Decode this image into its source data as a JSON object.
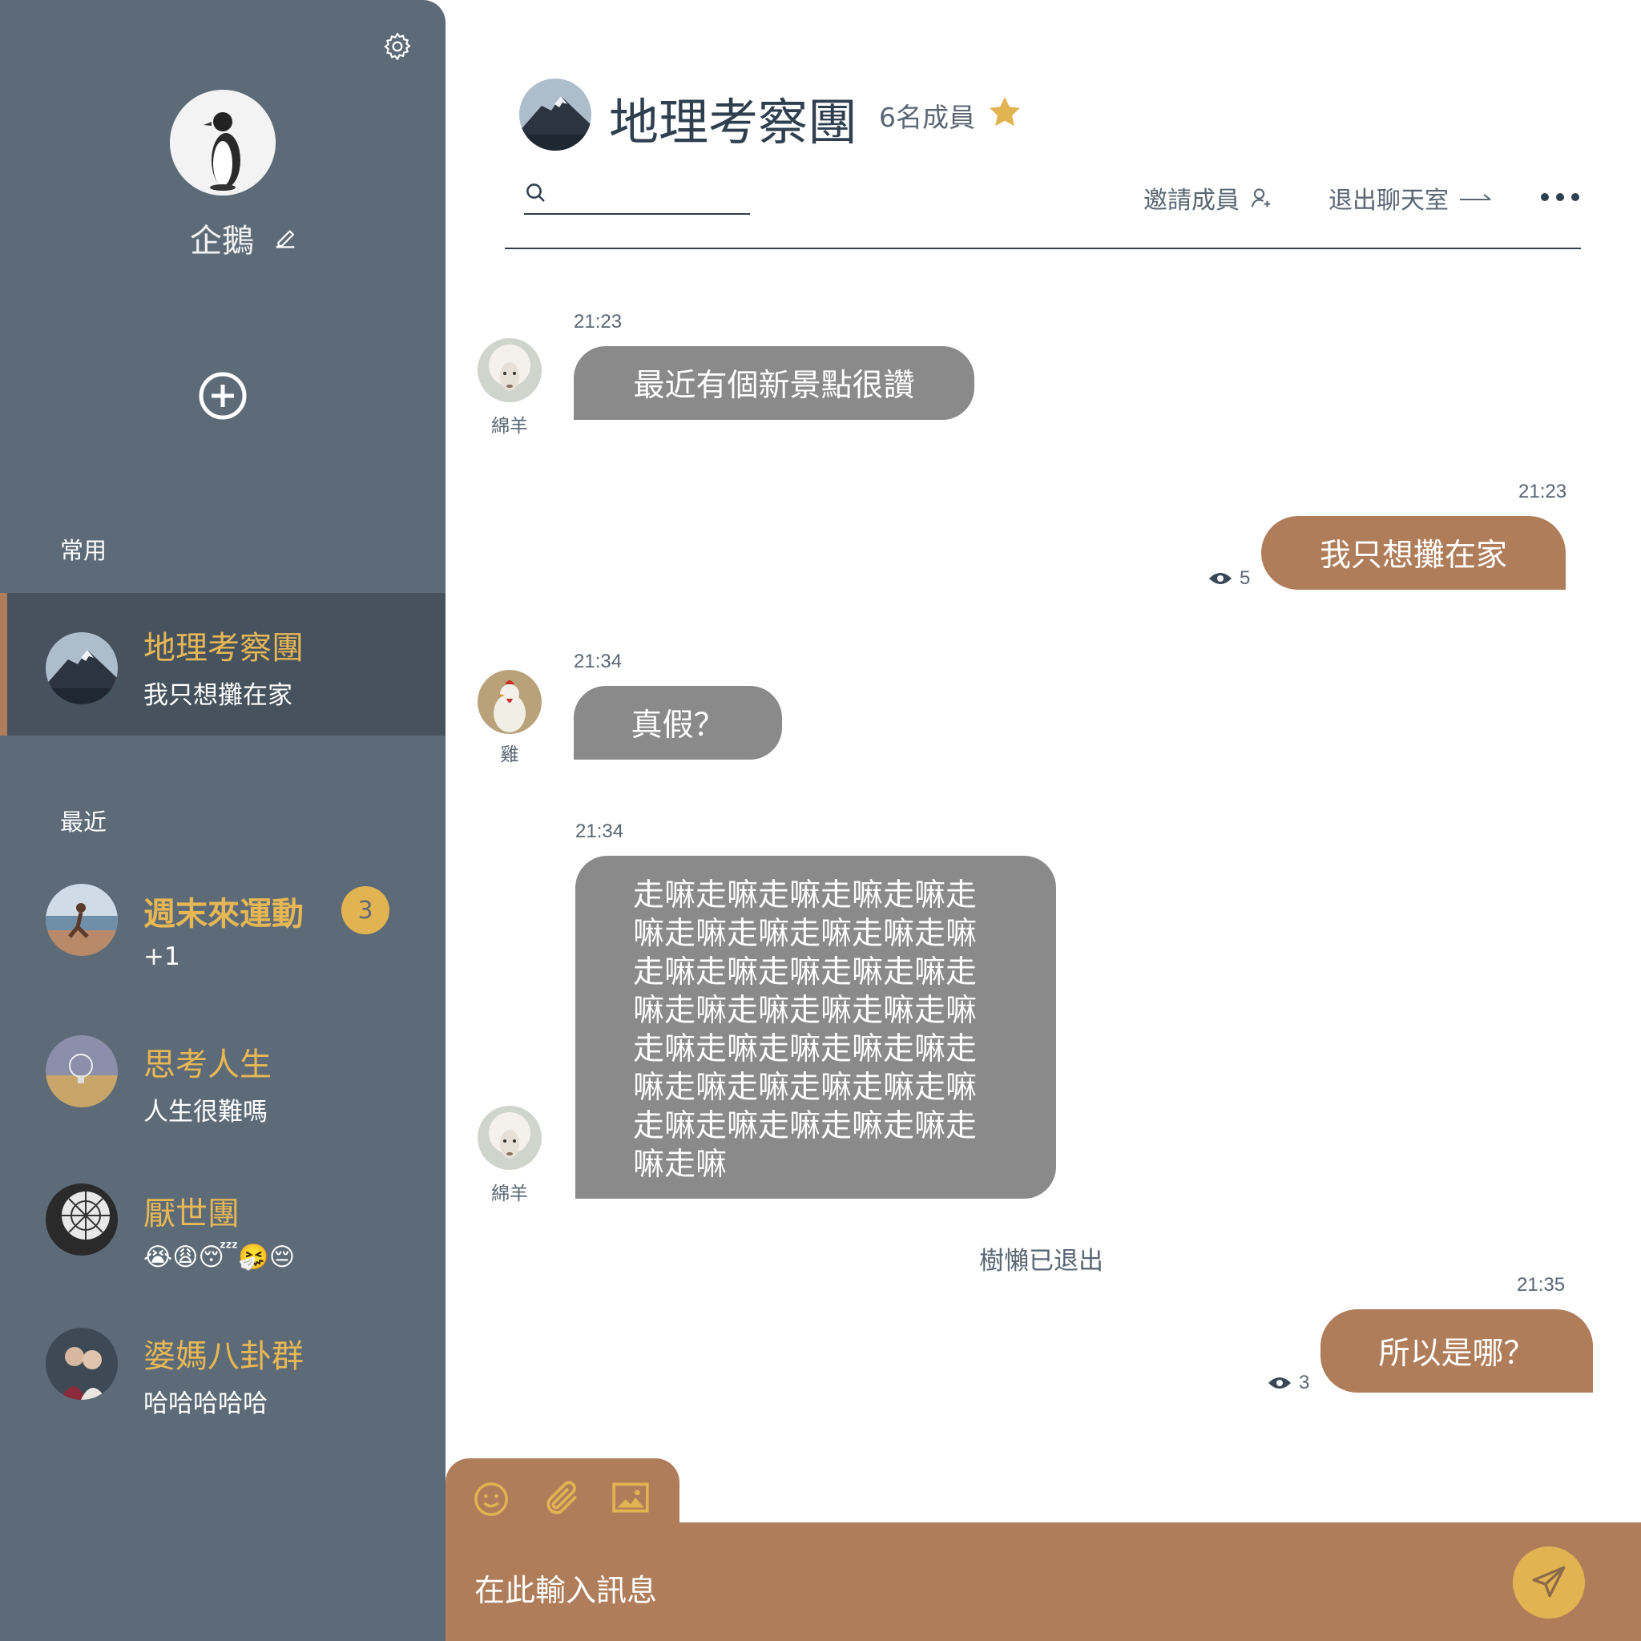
{
  "profile": {
    "name": "企鵝"
  },
  "sidebar": {
    "favorites_title": "常用",
    "recent_title": "最近",
    "favorites": [
      {
        "title": "地理考察團",
        "subtitle": "我只想攤在家"
      }
    ],
    "recent": [
      {
        "title": "週末來運動",
        "subtitle": "+1",
        "badge": "3"
      },
      {
        "title": "思考人生",
        "subtitle": "人生很難嗎"
      },
      {
        "title": "厭世團",
        "subtitle": "😭😩😴🤧😔"
      },
      {
        "title": "婆媽八卦群",
        "subtitle": "哈哈哈哈哈"
      }
    ]
  },
  "header": {
    "title": "地理考察團",
    "members": "6名成員",
    "invite_label": "邀請成員",
    "leave_label": "退出聊天室"
  },
  "messages": [
    {
      "time": "21:23",
      "sender": "綿羊",
      "text": "最近有個新景點很讚"
    },
    {
      "time": "21:23",
      "text": "我只想攤在家",
      "seen": "5"
    },
    {
      "time": "21:34",
      "sender": "雞",
      "text": "真假？"
    },
    {
      "time": "21:34",
      "sender": "綿羊",
      "lines": [
        "走嘛走嘛走嘛走嘛走嘛走",
        "嘛走嘛走嘛走嘛走嘛走嘛",
        "走嘛走嘛走嘛走嘛走嘛走",
        "嘛走嘛走嘛走嘛走嘛走嘛",
        "走嘛走嘛走嘛走嘛走嘛走",
        "嘛走嘛走嘛走嘛走嘛走嘛",
        "走嘛走嘛走嘛走嘛走嘛走",
        "嘛走嘛"
      ]
    },
    {
      "system": "樹懶已退出"
    },
    {
      "time": "21:35",
      "text": "所以是哪？",
      "seen": "3"
    }
  ],
  "composer": {
    "placeholder": "在此輸入訊息"
  },
  "colors": {
    "sidebar": "#5d6b78",
    "accent_gold": "#e2b351",
    "brown": "#b07d5b",
    "incoming": "#8a8a8a"
  }
}
